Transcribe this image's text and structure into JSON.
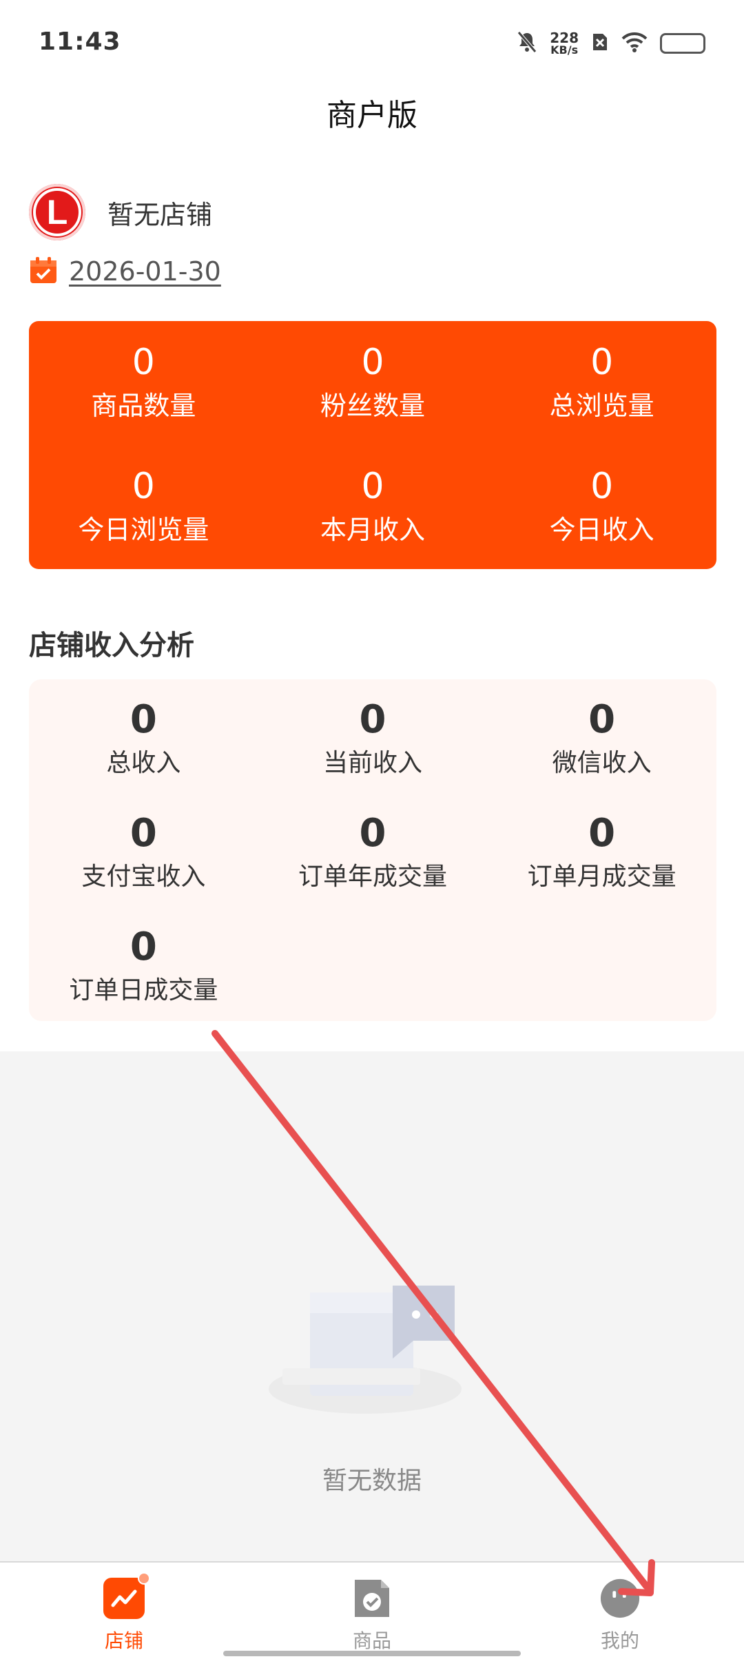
{
  "status_bar": {
    "time": "11:43",
    "net_speed_value": "228",
    "net_speed_unit": "KB/s"
  },
  "header": {
    "title": "商户版"
  },
  "shop": {
    "avatar_letter": "L",
    "name": "暂无店铺",
    "date": "2026-01-30"
  },
  "stats": [
    {
      "value": "0",
      "label": "商品数量"
    },
    {
      "value": "0",
      "label": "粉丝数量"
    },
    {
      "value": "0",
      "label": "总浏览量"
    },
    {
      "value": "0",
      "label": "今日浏览量"
    },
    {
      "value": "0",
      "label": "本月收入"
    },
    {
      "value": "0",
      "label": "今日收入"
    }
  ],
  "income_section": {
    "title": "店铺收入分析",
    "items": [
      {
        "value": "0",
        "label": "总收入"
      },
      {
        "value": "0",
        "label": "当前收入"
      },
      {
        "value": "0",
        "label": "微信收入"
      },
      {
        "value": "0",
        "label": "支付宝收入"
      },
      {
        "value": "0",
        "label": "订单年成交量"
      },
      {
        "value": "0",
        "label": "订单月成交量"
      },
      {
        "value": "0",
        "label": "订单日成交量"
      }
    ]
  },
  "empty_state": {
    "text": "暂无数据"
  },
  "tabs": [
    {
      "label": "店铺",
      "icon": "chart-trend-icon",
      "active": true
    },
    {
      "label": "商品",
      "icon": "document-check-icon",
      "active": false
    },
    {
      "label": "我的",
      "icon": "profile-face-icon",
      "active": false
    }
  ],
  "colors": {
    "brand": "#ff4a03",
    "income_bg": "#fff6f3",
    "annotation_arrow": "#e85050"
  }
}
